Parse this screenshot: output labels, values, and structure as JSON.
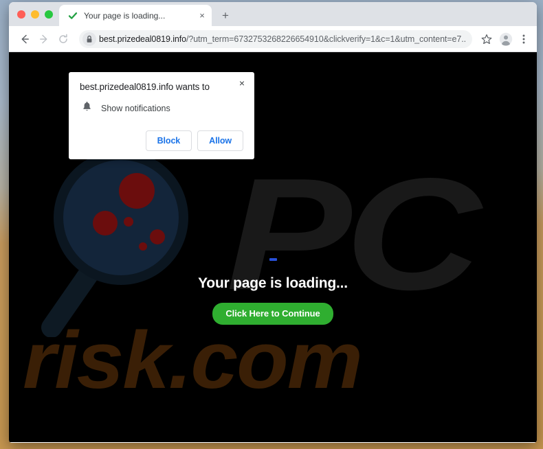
{
  "window": {
    "traffic_lights": [
      "close",
      "minimize",
      "maximize"
    ],
    "colors": {
      "close": "#ff5f57",
      "minimize": "#febc2e",
      "maximize": "#28c840",
      "tabstrip_bg": "#dee1e6",
      "toolbar_bg": "#ffffff",
      "omnibox_bg": "#f1f3f4"
    }
  },
  "tab": {
    "favicon": "green-check-icon",
    "title": "Your page is loading...",
    "close_label": "×",
    "new_tab_label": "+"
  },
  "toolbar": {
    "back_icon": "back-arrow-icon",
    "forward_icon": "forward-arrow-icon",
    "reload_icon": "reload-icon",
    "lock_icon": "lock-icon",
    "url_host": "best.prizedeal0819.info",
    "url_path": "/?utm_term=6732753268226654910&clickverify=1&c=1&utm_content=e7...",
    "bookmark_icon": "star-icon",
    "profile_icon": "avatar-icon",
    "menu_icon": "three-dot-menu-icon"
  },
  "notification_dialog": {
    "title": "best.prizedeal0819.info wants to",
    "permission_icon": "bell-icon",
    "permission_label": "Show notifications",
    "close_label": "×",
    "block_label": "Block",
    "allow_label": "Allow",
    "accent_color": "#1a73e8"
  },
  "page": {
    "background_color": "#000000",
    "heading": "Your page is loading...",
    "button_label": "Click Here to Continue",
    "button_color": "#2fae30",
    "spinner_color": "#2850d8",
    "watermark_pc": "PC",
    "watermark_risk": "risk.com",
    "watermark_pc_color": "#191919",
    "watermark_risk_color": "#3a1f06",
    "magnifier_icon": "magnifying-glass-virus-icon"
  }
}
